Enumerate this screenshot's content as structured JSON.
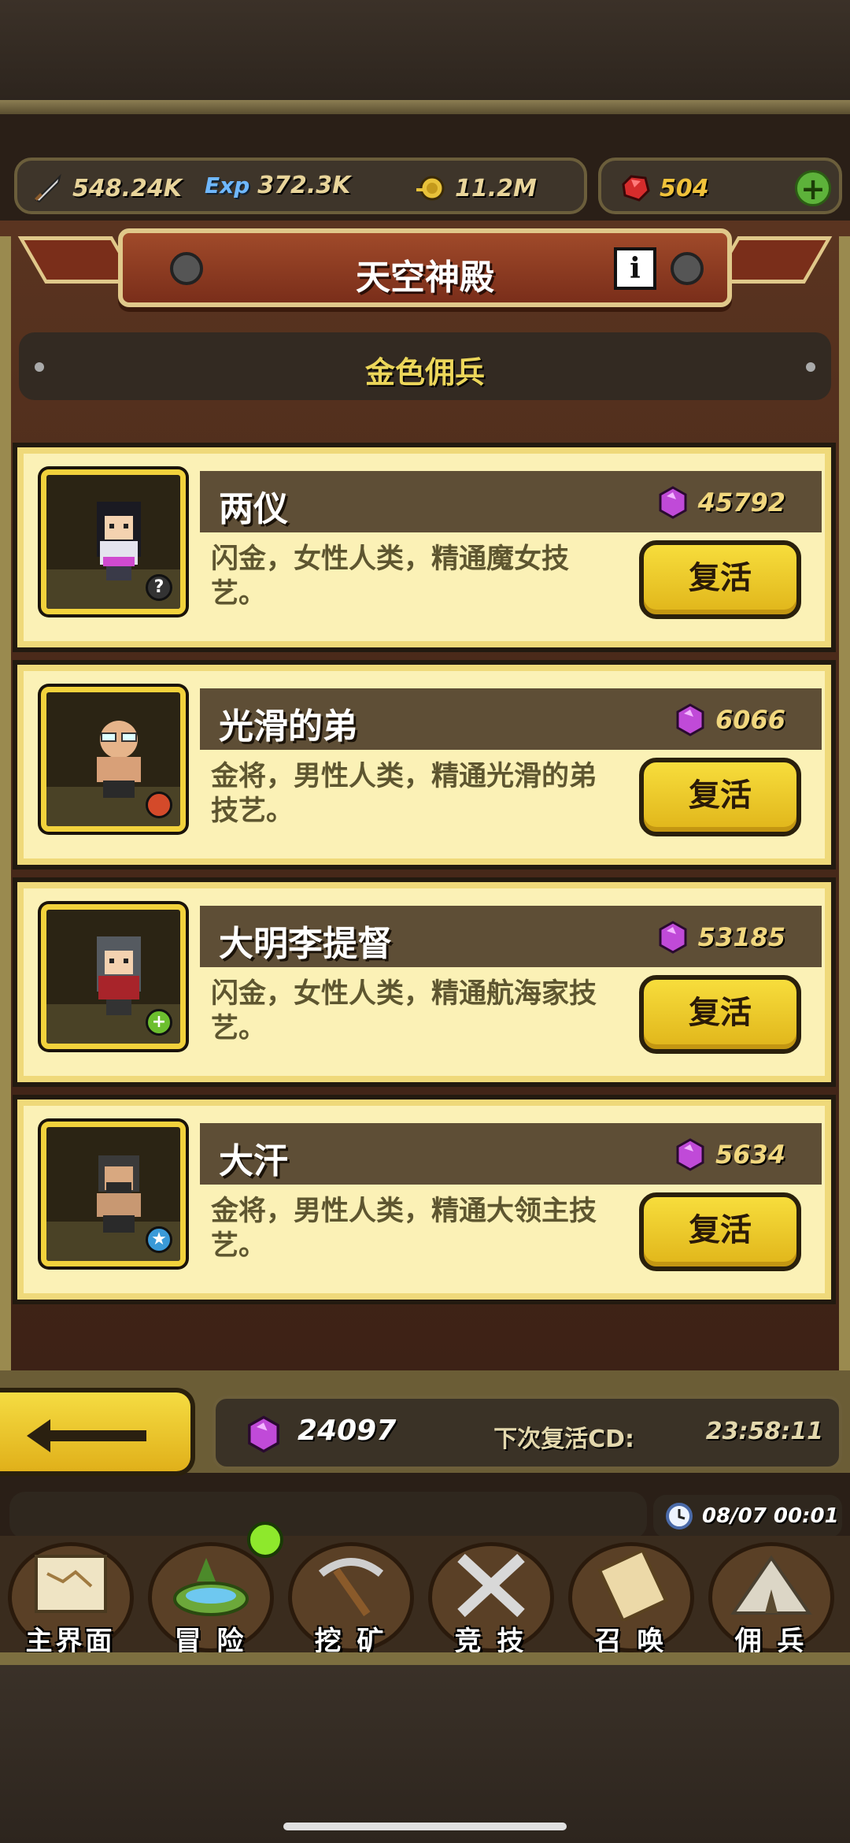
{
  "resources": {
    "attack": "548.24K",
    "exp_label": "Exp",
    "exp": "372.3K",
    "gold": "11.2M",
    "ruby": "504"
  },
  "title": "天空神殿",
  "info_label": "i",
  "subtitle": "金色佣兵",
  "mercenaries": [
    {
      "name": "两仪",
      "cost": "45792",
      "desc": "闪金，女性人类，精通魔女技艺。",
      "button": "复活",
      "badge": "?"
    },
    {
      "name": "光滑的弟",
      "cost": "6066",
      "desc": "金将，男性人类，精通光滑的弟技艺。",
      "button": "复活",
      "badge": ""
    },
    {
      "name": "大明李提督",
      "cost": "53185",
      "desc": "闪金，女性人类，精通航海家技艺。",
      "button": "复活",
      "badge": "+"
    },
    {
      "name": "大汗",
      "cost": "5634",
      "desc": "金将，男性人类，精通大领主技艺。",
      "button": "复活",
      "badge": "★"
    }
  ],
  "footer": {
    "gems": "24097",
    "cd_label": "下次复活CD:",
    "cd_time": "23:58:11"
  },
  "clock": "08/07 00:01",
  "nav": [
    {
      "label": "主界面"
    },
    {
      "label": "冒 险"
    },
    {
      "label": "挖 矿"
    },
    {
      "label": "竞 技"
    },
    {
      "label": "召 唤"
    },
    {
      "label": "佣 兵"
    }
  ],
  "colors": {
    "card_bg": "#fbf1b6",
    "button_yellow": "#f2d23c",
    "banner_red": "#8a3a22",
    "gem_purple": "#c04ad8"
  }
}
